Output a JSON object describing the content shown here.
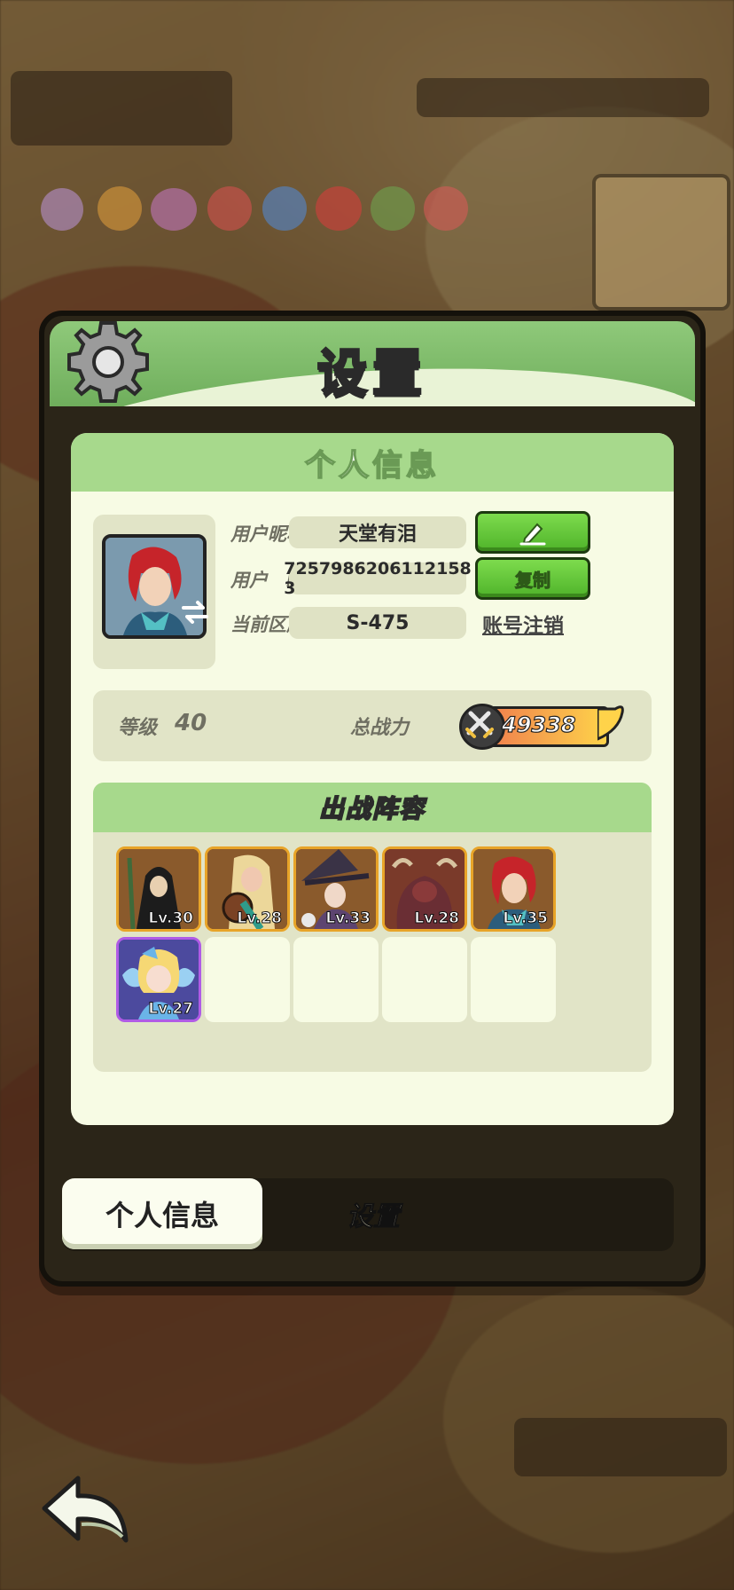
{
  "panel": {
    "title": "设置"
  },
  "profile_card": {
    "header": "个人信息",
    "nickname_label": "用户昵称",
    "nickname_value": "天堂有泪",
    "id_label": "用户　ID",
    "id_value": "7257986206112158​3",
    "server_label": "当前区服",
    "server_value": "S-475",
    "copy_label": "复制",
    "delete_account_label": "账号注销",
    "level_label": "等级",
    "level_value": "40",
    "power_label": "总战力",
    "power_value": "49338"
  },
  "lineup": {
    "header": "出战阵容",
    "heroes": [
      {
        "level": "Lv.30",
        "portrait": "hooded-sage",
        "frame": "gold"
      },
      {
        "level": "Lv.28",
        "portrait": "bard-girl",
        "frame": "gold"
      },
      {
        "level": "Lv.33",
        "portrait": "witch-hat",
        "frame": "gold"
      },
      {
        "level": "Lv.28",
        "portrait": "horned-beast",
        "frame": "gold"
      },
      {
        "level": "Lv.35",
        "portrait": "red-hair-hero",
        "frame": "gold"
      },
      {
        "level": "Lv.27",
        "portrait": "fairy-girl",
        "frame": "purple"
      }
    ],
    "empty_slots": 4
  },
  "tabs": {
    "active": "个人信息",
    "inactive": "设置"
  },
  "colors": {
    "accent_green": "#a7d98c",
    "button_green": "#4fb32a",
    "card_bg": "#f7fbe4",
    "panel_dark": "#2b2518"
  }
}
